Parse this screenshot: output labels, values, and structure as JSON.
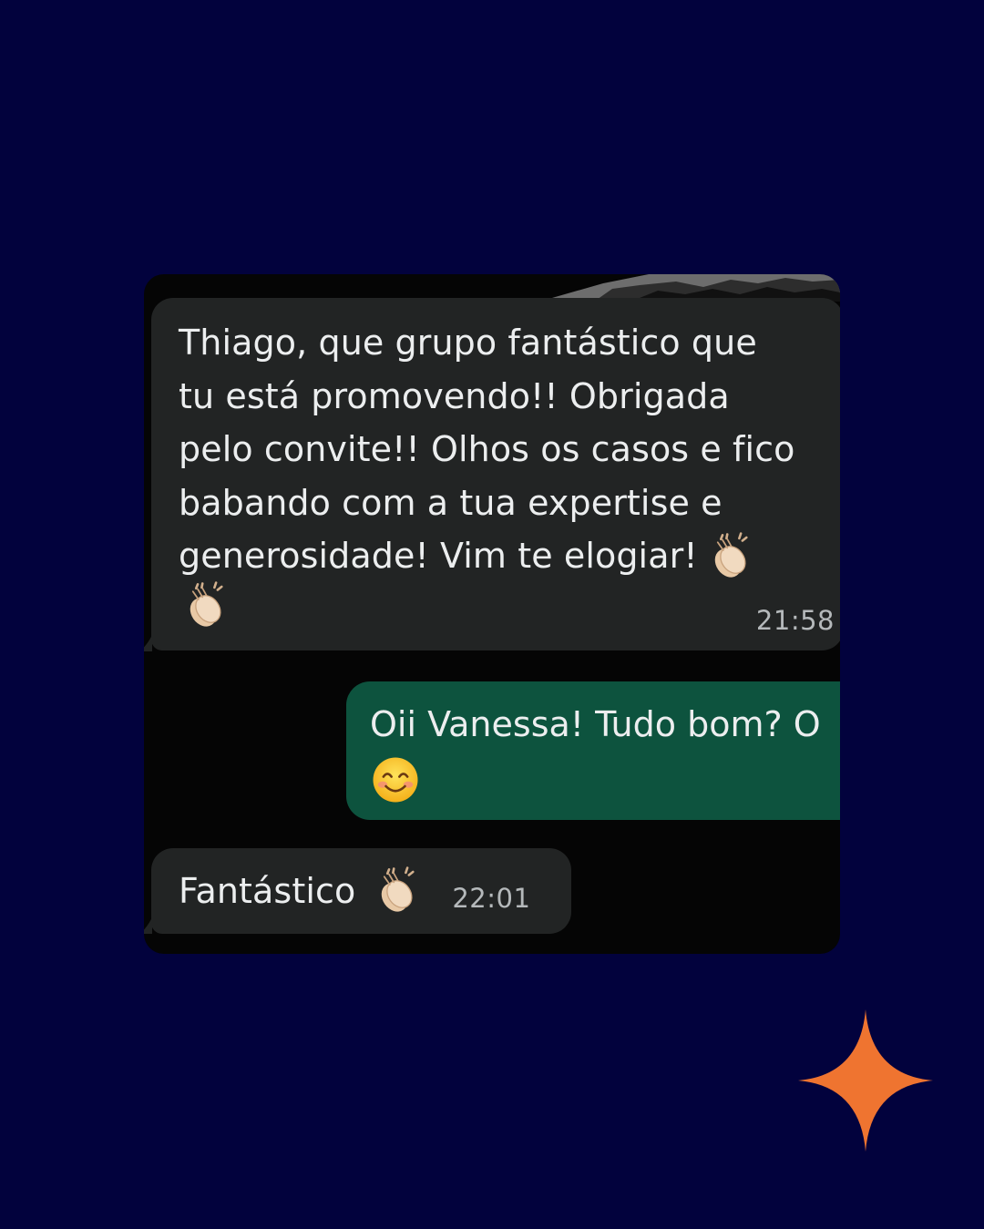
{
  "conversation": {
    "messages": [
      {
        "direction": "incoming",
        "text": "Thiago, que grupo fantástico que\ntu está promovendo!! Obrigada\npelo convite!! Olhos os casos e fico\nbabando com a tua expertise e\ngenerosidade! Vim te elogiar!",
        "emojis": [
          "clapping-hands",
          "clapping-hands"
        ],
        "time": "21:58"
      },
      {
        "direction": "outgoing",
        "text": "Oii Vanessa! Tudo bom? O",
        "emojis": [
          "smiling-face-with-smiling-eyes"
        ]
      },
      {
        "direction": "incoming",
        "text": "Fantástico",
        "emojis": [
          "clapping-hands"
        ],
        "time": "22:01"
      }
    ]
  },
  "colors": {
    "page_background": "#02023d",
    "chat_background": "#050505",
    "incoming_bubble": "#222424",
    "outgoing_bubble": "#0d533e",
    "message_text": "#eceeef",
    "timestamp_text": "#b5b9bb",
    "sparkle_accent": "#ef7430"
  },
  "decorations": {
    "accent_icon": "four-point-sparkle-icon"
  }
}
